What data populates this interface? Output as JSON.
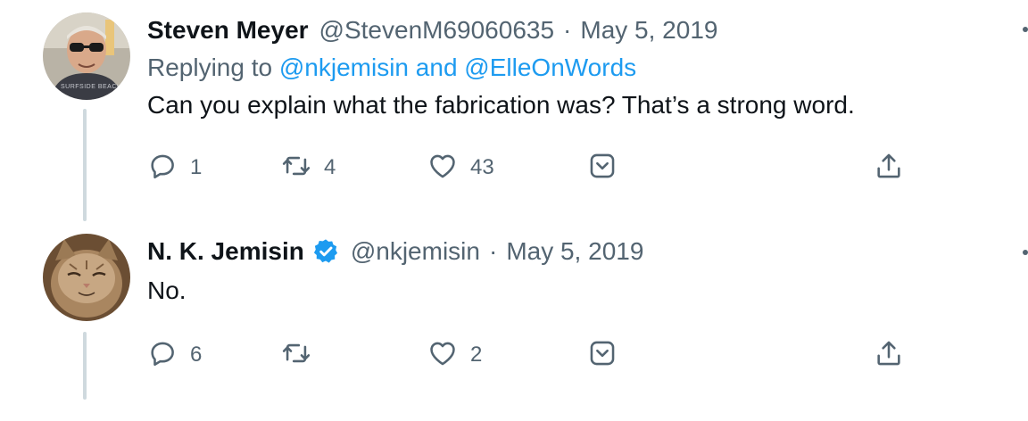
{
  "tweets": [
    {
      "author_name": "Steven Meyer",
      "handle": "@StevenM69060635",
      "separator": "·",
      "date": "May 5, 2019",
      "replying_prefix": "Replying to",
      "reply_mention_1": "@nkjemisin",
      "reply_and": "and",
      "reply_mention_2": "@ElleOnWords",
      "text": "Can you explain what the fabrication was? That’s a strong word.",
      "verified": false,
      "avatar_label": "SURFSIDE BEACH",
      "counts": {
        "reply": "1",
        "retweet": "4",
        "like": "43"
      }
    },
    {
      "author_name": "N. K. Jemisin",
      "handle": "@nkjemisin",
      "separator": "·",
      "date": "May 5, 2019",
      "text": "No.",
      "verified": true,
      "counts": {
        "reply": "6",
        "retweet": "",
        "like": "2"
      }
    }
  ],
  "colors": {
    "text": "#0f1419",
    "secondary": "#536471",
    "link": "#1d9bf0",
    "thread_line": "#cfd9de"
  },
  "icons": [
    "reply-icon",
    "retweet-icon",
    "like-icon",
    "share-icon",
    "dm-icon",
    "verified-icon",
    "more-icon"
  ]
}
